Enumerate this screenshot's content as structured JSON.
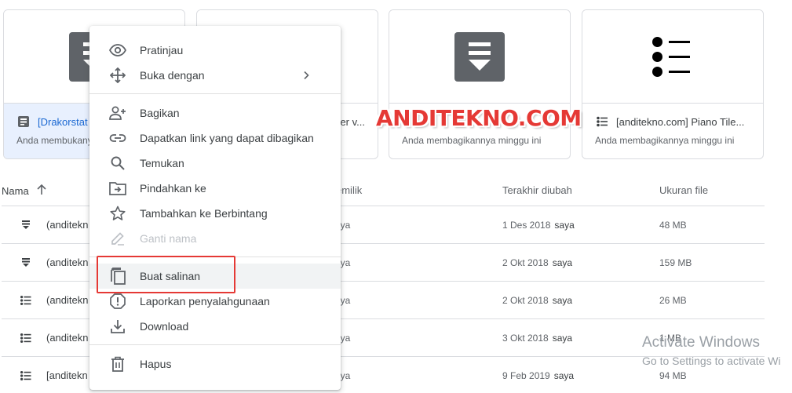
{
  "cards": [
    {
      "name": "[Drakorstat",
      "sub": "Anda membukany",
      "thumb": "doc-icon",
      "selected": true
    },
    {
      "name": "er v...",
      "sub": "",
      "thumb": "doc-icon",
      "selected": false
    },
    {
      "name": "",
      "sub": "Anda membagikannya minggu ini",
      "thumb": "doc-icon",
      "selected": false
    },
    {
      "name": "[anditekno.com] Piano Tile...",
      "sub": "Anda membagikannya minggu ini",
      "thumb": "list-icon",
      "selected": false
    }
  ],
  "table": {
    "headers": {
      "name": "Nama",
      "owner": "emilik",
      "modified": "Terakhir diubah",
      "size": "Ukuran file"
    },
    "rows": [
      {
        "icon": "doc-icon",
        "name": "(anditekn",
        "owner": "aya",
        "date": "1 Des 2018",
        "by": "saya",
        "size": "48 MB"
      },
      {
        "icon": "doc-icon",
        "name": "(anditekn",
        "owner": "aya",
        "date": "2 Okt 2018",
        "by": "saya",
        "size": "159 MB"
      },
      {
        "icon": "list-icon",
        "name": "(anditekn",
        "owner": "aya",
        "date": "2 Okt 2018",
        "by": "saya",
        "size": "26 MB"
      },
      {
        "icon": "list-icon",
        "name": "(anditekn",
        "owner": "aya",
        "date": "3 Okt 2018",
        "by": "saya",
        "size": "1 MB"
      },
      {
        "icon": "list-icon",
        "name": "[anditekn",
        "owner": "aya",
        "date": "9 Feb 2019",
        "by": "saya",
        "size": "94 MB"
      }
    ]
  },
  "menu": {
    "preview": "Pratinjau",
    "open_with": "Buka dengan",
    "share": "Bagikan",
    "get_link": "Dapatkan link yang dapat dibagikan",
    "locate": "Temukan",
    "move_to": "Pindahkan ke",
    "add_star": "Tambahkan ke Berbintang",
    "rename": "Ganti nama",
    "make_copy": "Buat salinan",
    "report_abuse": "Laporkan penyalahgunaan",
    "download": "Download",
    "remove": "Hapus"
  },
  "watermark": {
    "brand": "ANDITEKNO.COM",
    "activate_title": "Activate Windows",
    "activate_sub": "Go to Settings to activate Wi"
  },
  "colors": {
    "accent_blue": "#1967d2",
    "selected_bg": "#e8f0fe",
    "highlight_red": "#e53935",
    "icon_gray": "#5f6368"
  }
}
